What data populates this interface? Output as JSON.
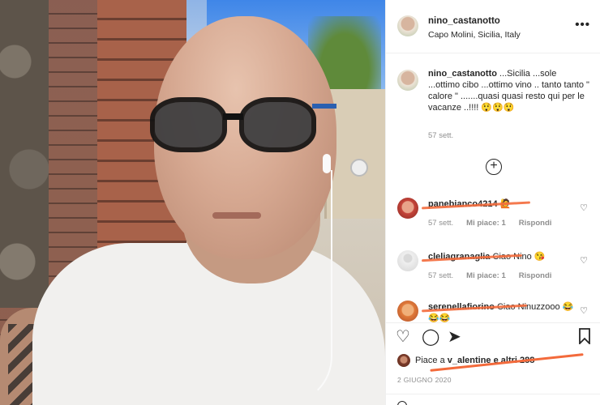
{
  "post": {
    "username": "nino_castanotto",
    "location": "Capo Molini, Sicilia, Italy",
    "more_label": "•••",
    "caption": {
      "username": "nino_castanotto",
      "text": " ...Sicilia ...sole ...ottimo cibo ...ottimo vino .. tanto tanto \" calore \" .......quasi quasi resto qui per le vacanze ..!!!! 😲😲😲",
      "time": "57 sett."
    },
    "load_more_label": "+"
  },
  "comments": [
    {
      "username": "panebianco4214",
      "text": " 🙋",
      "time": "57 sett.",
      "likes": "Mi piace: 1",
      "reply": "Rispondi"
    },
    {
      "username": "cleliagranaglia",
      "text": " Ciao Nino 😘",
      "time": "57 sett.",
      "likes": "Mi piace: 1",
      "reply": "Rispondi"
    },
    {
      "username": "serenellafiorino",
      "text": " Ciao Ninuzzooo 😂😂😂",
      "time": "",
      "likes": "",
      "reply": ""
    }
  ],
  "actions": {
    "like_icon": "heart-icon",
    "comment_icon": "comment-icon",
    "share_icon": "share-icon",
    "save_icon": "bookmark-icon"
  },
  "likes": {
    "prefix": "Piace a ",
    "user": "v_alentine",
    "suffix": " e altri 288"
  },
  "date": "2 GIUGNO 2020",
  "colors": {
    "accent_scribble": "#f36a3b",
    "meta_gray": "#8e8e8e"
  }
}
